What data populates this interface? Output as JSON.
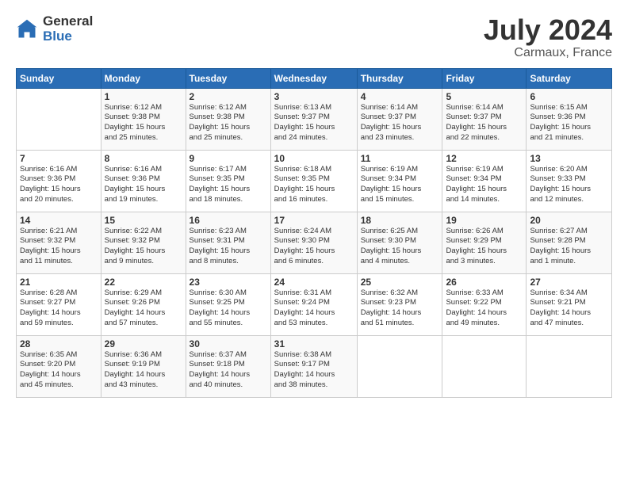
{
  "header": {
    "logo_general": "General",
    "logo_blue": "Blue",
    "month_year": "July 2024",
    "location": "Carmaux, France"
  },
  "calendar": {
    "days_of_week": [
      "Sunday",
      "Monday",
      "Tuesday",
      "Wednesday",
      "Thursday",
      "Friday",
      "Saturday"
    ],
    "weeks": [
      [
        {
          "day": "",
          "info": ""
        },
        {
          "day": "1",
          "info": "Sunrise: 6:12 AM\nSunset: 9:38 PM\nDaylight: 15 hours\nand 25 minutes."
        },
        {
          "day": "2",
          "info": "Sunrise: 6:12 AM\nSunset: 9:38 PM\nDaylight: 15 hours\nand 25 minutes."
        },
        {
          "day": "3",
          "info": "Sunrise: 6:13 AM\nSunset: 9:37 PM\nDaylight: 15 hours\nand 24 minutes."
        },
        {
          "day": "4",
          "info": "Sunrise: 6:14 AM\nSunset: 9:37 PM\nDaylight: 15 hours\nand 23 minutes."
        },
        {
          "day": "5",
          "info": "Sunrise: 6:14 AM\nSunset: 9:37 PM\nDaylight: 15 hours\nand 22 minutes."
        },
        {
          "day": "6",
          "info": "Sunrise: 6:15 AM\nSunset: 9:36 PM\nDaylight: 15 hours\nand 21 minutes."
        }
      ],
      [
        {
          "day": "7",
          "info": "Sunrise: 6:16 AM\nSunset: 9:36 PM\nDaylight: 15 hours\nand 20 minutes."
        },
        {
          "day": "8",
          "info": "Sunrise: 6:16 AM\nSunset: 9:36 PM\nDaylight: 15 hours\nand 19 minutes."
        },
        {
          "day": "9",
          "info": "Sunrise: 6:17 AM\nSunset: 9:35 PM\nDaylight: 15 hours\nand 18 minutes."
        },
        {
          "day": "10",
          "info": "Sunrise: 6:18 AM\nSunset: 9:35 PM\nDaylight: 15 hours\nand 16 minutes."
        },
        {
          "day": "11",
          "info": "Sunrise: 6:19 AM\nSunset: 9:34 PM\nDaylight: 15 hours\nand 15 minutes."
        },
        {
          "day": "12",
          "info": "Sunrise: 6:19 AM\nSunset: 9:34 PM\nDaylight: 15 hours\nand 14 minutes."
        },
        {
          "day": "13",
          "info": "Sunrise: 6:20 AM\nSunset: 9:33 PM\nDaylight: 15 hours\nand 12 minutes."
        }
      ],
      [
        {
          "day": "14",
          "info": "Sunrise: 6:21 AM\nSunset: 9:32 PM\nDaylight: 15 hours\nand 11 minutes."
        },
        {
          "day": "15",
          "info": "Sunrise: 6:22 AM\nSunset: 9:32 PM\nDaylight: 15 hours\nand 9 minutes."
        },
        {
          "day": "16",
          "info": "Sunrise: 6:23 AM\nSunset: 9:31 PM\nDaylight: 15 hours\nand 8 minutes."
        },
        {
          "day": "17",
          "info": "Sunrise: 6:24 AM\nSunset: 9:30 PM\nDaylight: 15 hours\nand 6 minutes."
        },
        {
          "day": "18",
          "info": "Sunrise: 6:25 AM\nSunset: 9:30 PM\nDaylight: 15 hours\nand 4 minutes."
        },
        {
          "day": "19",
          "info": "Sunrise: 6:26 AM\nSunset: 9:29 PM\nDaylight: 15 hours\nand 3 minutes."
        },
        {
          "day": "20",
          "info": "Sunrise: 6:27 AM\nSunset: 9:28 PM\nDaylight: 15 hours\nand 1 minute."
        }
      ],
      [
        {
          "day": "21",
          "info": "Sunrise: 6:28 AM\nSunset: 9:27 PM\nDaylight: 14 hours\nand 59 minutes."
        },
        {
          "day": "22",
          "info": "Sunrise: 6:29 AM\nSunset: 9:26 PM\nDaylight: 14 hours\nand 57 minutes."
        },
        {
          "day": "23",
          "info": "Sunrise: 6:30 AM\nSunset: 9:25 PM\nDaylight: 14 hours\nand 55 minutes."
        },
        {
          "day": "24",
          "info": "Sunrise: 6:31 AM\nSunset: 9:24 PM\nDaylight: 14 hours\nand 53 minutes."
        },
        {
          "day": "25",
          "info": "Sunrise: 6:32 AM\nSunset: 9:23 PM\nDaylight: 14 hours\nand 51 minutes."
        },
        {
          "day": "26",
          "info": "Sunrise: 6:33 AM\nSunset: 9:22 PM\nDaylight: 14 hours\nand 49 minutes."
        },
        {
          "day": "27",
          "info": "Sunrise: 6:34 AM\nSunset: 9:21 PM\nDaylight: 14 hours\nand 47 minutes."
        }
      ],
      [
        {
          "day": "28",
          "info": "Sunrise: 6:35 AM\nSunset: 9:20 PM\nDaylight: 14 hours\nand 45 minutes."
        },
        {
          "day": "29",
          "info": "Sunrise: 6:36 AM\nSunset: 9:19 PM\nDaylight: 14 hours\nand 43 minutes."
        },
        {
          "day": "30",
          "info": "Sunrise: 6:37 AM\nSunset: 9:18 PM\nDaylight: 14 hours\nand 40 minutes."
        },
        {
          "day": "31",
          "info": "Sunrise: 6:38 AM\nSunset: 9:17 PM\nDaylight: 14 hours\nand 38 minutes."
        },
        {
          "day": "",
          "info": ""
        },
        {
          "day": "",
          "info": ""
        },
        {
          "day": "",
          "info": ""
        }
      ]
    ]
  }
}
